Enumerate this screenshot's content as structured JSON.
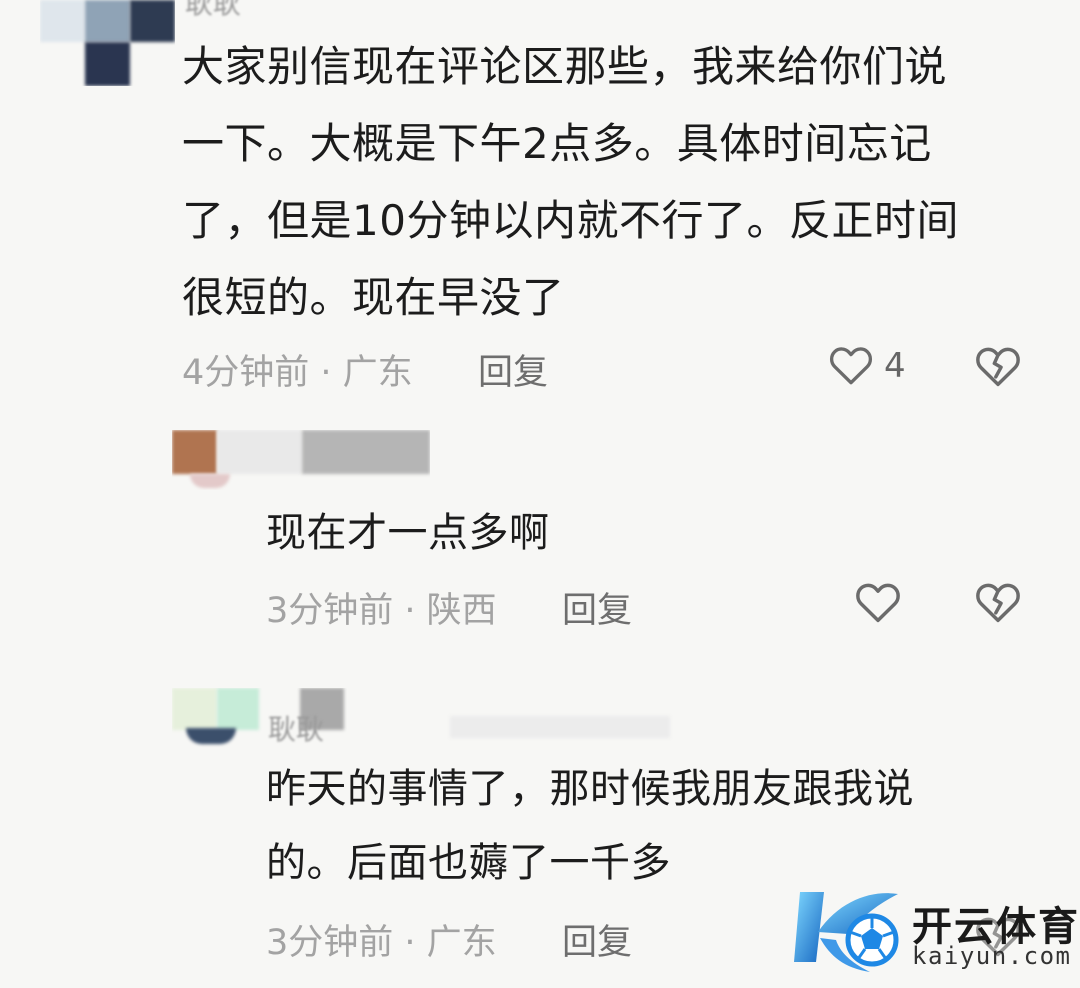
{
  "comments": [
    {
      "username": "耿耿",
      "text_lines": [
        "大家别信现在评论区那些，我来给你们说",
        "一下。大概是下午2点多。具体时间忘记",
        "了，但是10分钟以内就不行了。反正时间",
        "很短的。现在早没了"
      ],
      "meta": "4分钟前 · 广东",
      "reply_label": "回复",
      "likes": "4"
    },
    {
      "username": "",
      "text": "现在才一点多啊",
      "meta": "3分钟前 · 陕西",
      "reply_label": "回复"
    },
    {
      "username": "耿耿",
      "text_lines": [
        "昨天的事情了，那时候我朋友跟我说",
        "的。后面也薅了一千多"
      ],
      "meta": "3分钟前 · 广东",
      "reply_label": "回复"
    }
  ],
  "watermark": {
    "title": "开云体育",
    "subtitle": "kaiyun.com",
    "accent": "#1e88e5"
  },
  "icons": {
    "like": "heart-outline-icon",
    "dislike": "broken-heart-icon"
  }
}
